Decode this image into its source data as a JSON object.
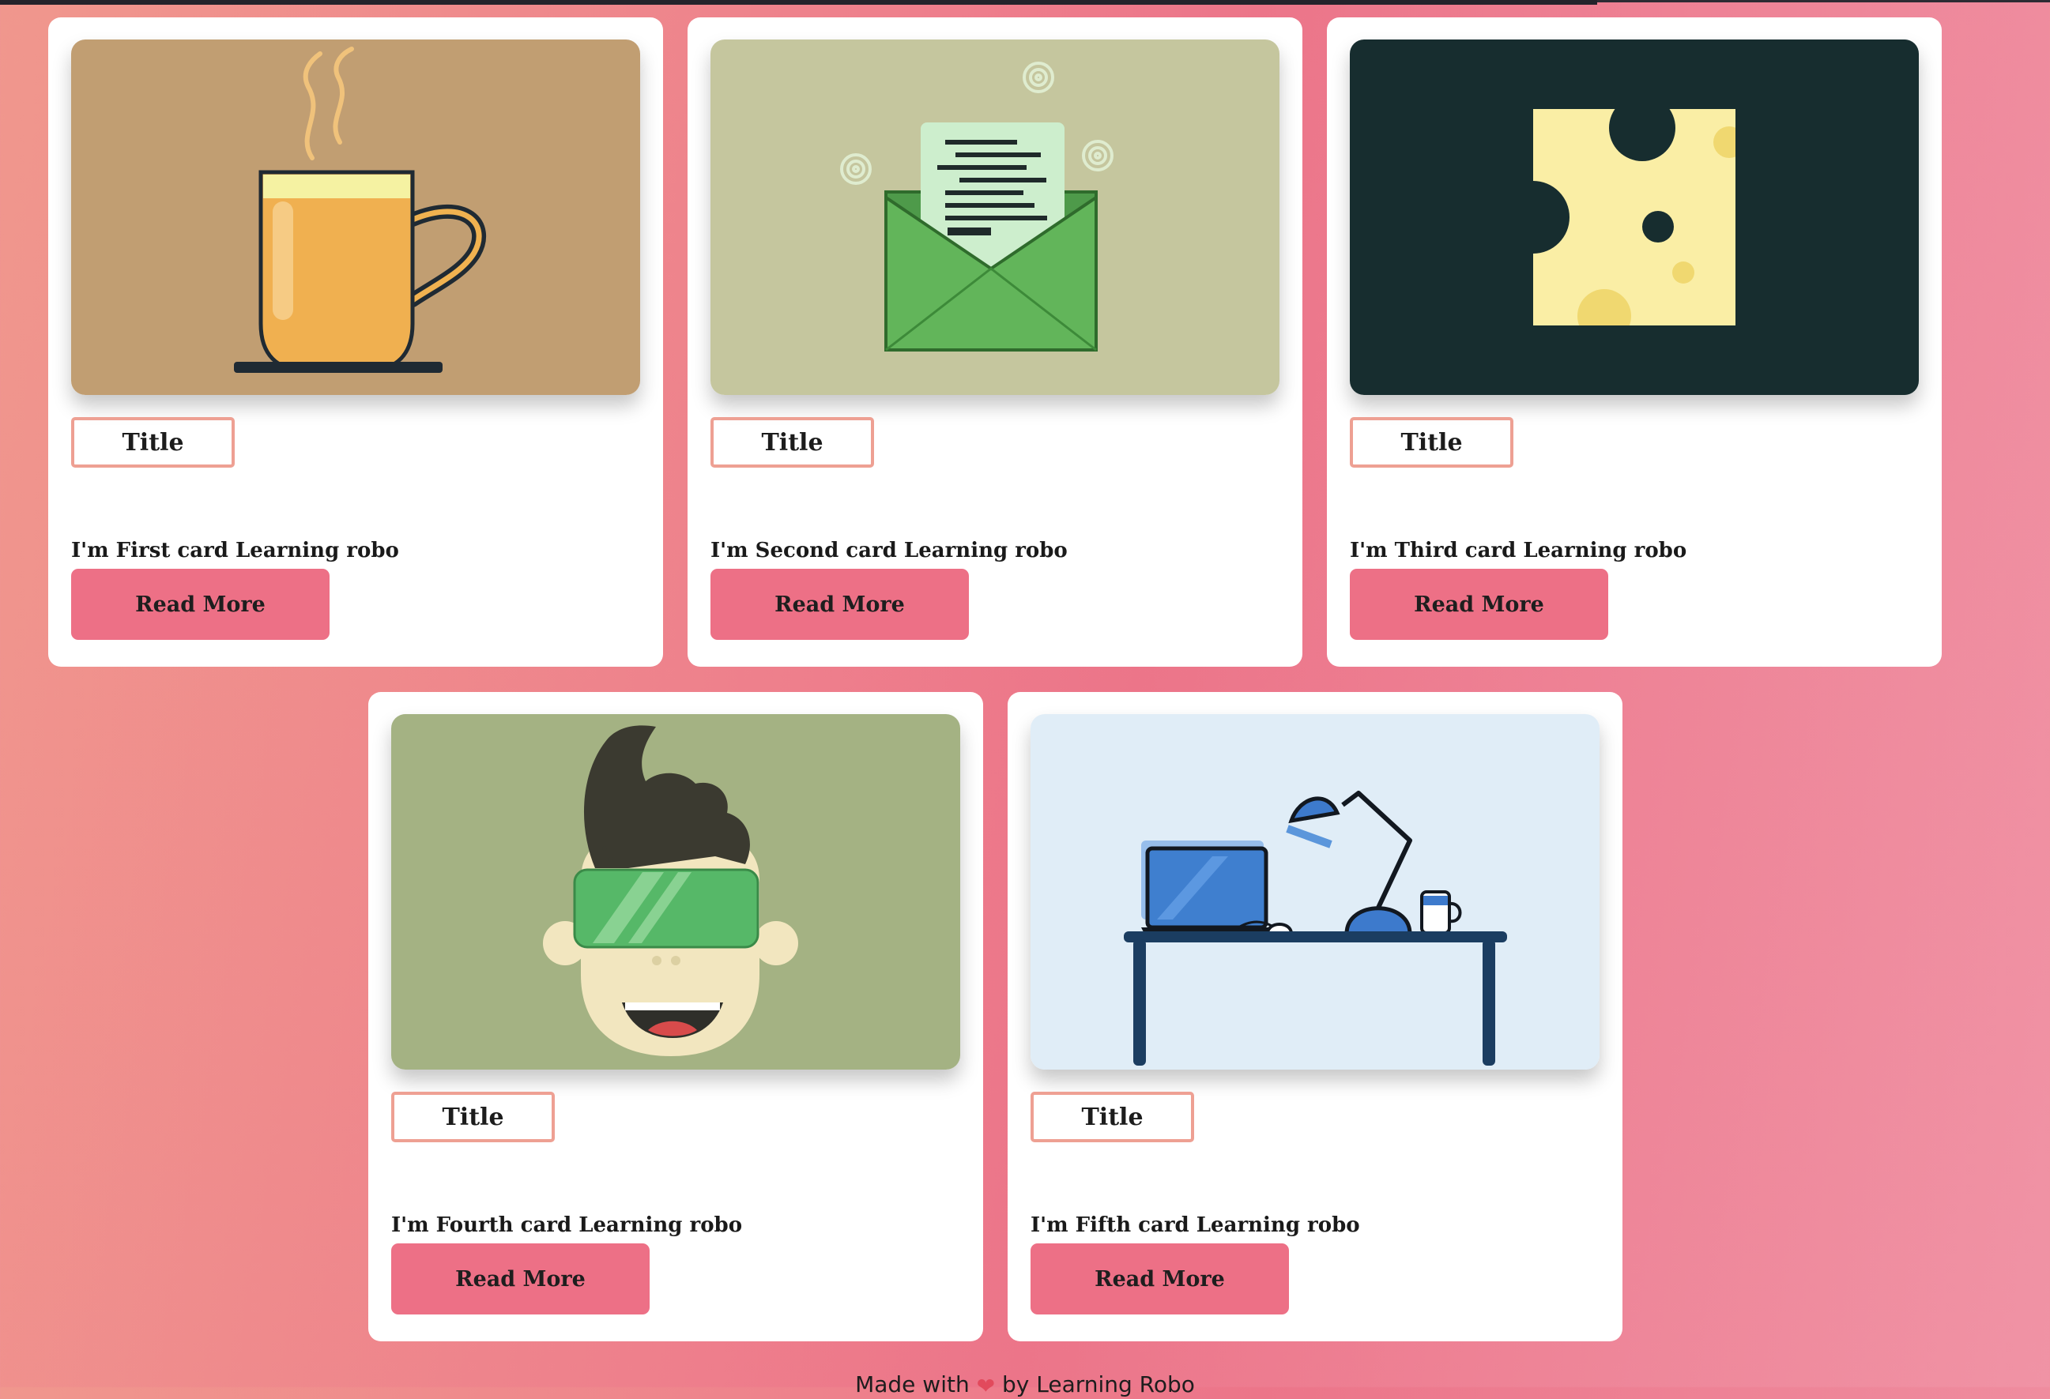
{
  "cards": [
    {
      "title": "Title",
      "description": "I'm First card Learning robo",
      "button_label": "Read More",
      "image_name": "coffee-mug-illustration",
      "image_bg": "#c19e72"
    },
    {
      "title": "Title",
      "description": "I'm Second card Learning robo",
      "button_label": "Read More",
      "image_name": "open-envelope-illustration",
      "image_bg": "#c5c69e"
    },
    {
      "title": "Title",
      "description": "I'm Third card Learning robo",
      "button_label": "Read More",
      "image_name": "cheese-illustration",
      "image_bg": "#172d2f"
    },
    {
      "title": "Title",
      "description": "I'm Fourth card Learning robo",
      "button_label": "Read More",
      "image_name": "vr-headset-boy-illustration",
      "image_bg": "#a4b283"
    },
    {
      "title": "Title",
      "description": "I'm Fifth card Learning robo",
      "button_label": "Read More",
      "image_name": "desk-laptop-lamp-illustration",
      "image_bg": "#e0edf7"
    }
  ],
  "footer": {
    "prefix": "Made with",
    "icon": "heart-icon",
    "suffix": "by Learning Robo"
  },
  "colors": {
    "button": "#ed7086",
    "title_border": "#eea093",
    "card_bg": "#ffffff"
  }
}
